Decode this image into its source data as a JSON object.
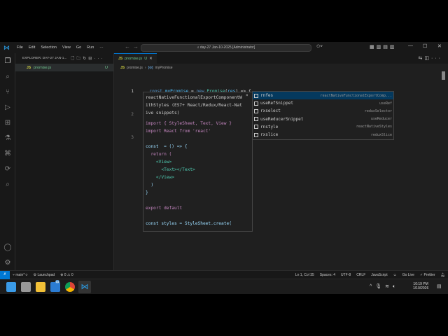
{
  "menu": [
    "File",
    "Edit",
    "Selection",
    "View",
    "Go",
    "Run",
    "···"
  ],
  "command_center": "day-27 Jan-10-2025 [Administrator]",
  "explorer": {
    "title": "EXPLORER: DAY-27 JAN-1...",
    "files": [
      {
        "name": "promise.js",
        "status": "U"
      }
    ]
  },
  "tab": {
    "name": "promise.js",
    "status": "U"
  },
  "breadcrumb": {
    "file": "promise.js",
    "symbol": "myPromise"
  },
  "code": {
    "line1": {
      "num": "1",
      "text": [
        "const ",
        "myPromise",
        " = ",
        "new ",
        "Promise",
        "(",
        "res",
        ") => {"
      ]
    },
    "line2": {
      "num": "2",
      "text": "'"
    },
    "line3": {
      "num": "3",
      "text": "}"
    }
  },
  "hover": {
    "title": "reactNativeFunctionalExportComponentWithStyles (ES7+ React/Redux/React-Native snippets)",
    "close": "×",
    "snippet": [
      "import { StyleSheet, Text, View }",
      "import React from 'react'",
      "",
      "const  = () => {",
      "  return (",
      "    <View>",
      "      <Text></Text>",
      "    </View>",
      "  )",
      "}",
      "",
      "export default",
      "",
      "const styles = StyleSheet.create("
    ]
  },
  "suggestions": [
    {
      "label": "rnfes",
      "detail": "reactNativeFunctionalExportComp...",
      "selected": true
    },
    {
      "label": "useRefSnippet",
      "detail": "useRef"
    },
    {
      "label": "rxselect",
      "detail": "reduxSelector"
    },
    {
      "label": "useReducerSnippet",
      "detail": "useReducer"
    },
    {
      "label": "rnstyle",
      "detail": "reactNativeStyles"
    },
    {
      "label": "rxslice",
      "detail": "reduxSlice"
    }
  ],
  "status": {
    "branch": "main*",
    "launchpad": "Launchpad",
    "problems": "⊗ 0 ⚠ 0",
    "position": "Ln 1, Col 35",
    "spaces": "Spaces: 4",
    "encoding": "UTF-8",
    "eol": "CRLF",
    "language": "JavaScript",
    "golive": "Go Live",
    "prettier": "✓ Prettier"
  },
  "taskbar": {
    "time": "10:19 PM",
    "date": "1/10/2026",
    "teams_badge": "64"
  },
  "colors": {
    "accent": "#0078d4",
    "selected": "#04395e"
  }
}
